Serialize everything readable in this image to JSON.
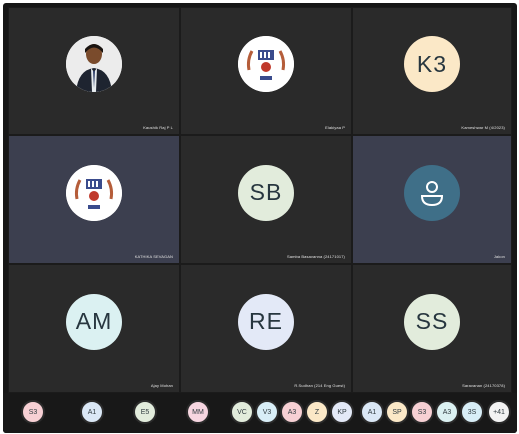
{
  "participants": [
    {
      "name": "Kaushik Raj P L",
      "avatar_type": "photo"
    },
    {
      "name": "Elakiyaa P",
      "avatar_type": "logo"
    },
    {
      "name": "Kameshwar M (4/2023)",
      "initials": "K3",
      "avatar_type": "initials",
      "color": "#fbe8c7"
    },
    {
      "name": "KATHIKA SEVAGAN",
      "avatar_type": "logo"
    },
    {
      "name": "Samba Basavanna (24171017)",
      "initials": "SB",
      "avatar_type": "initials",
      "color": "#e2ecdc"
    },
    {
      "name": "Jakon",
      "avatar_type": "icon",
      "icon": "user-silhouette-icon",
      "color": "#3f6f88"
    },
    {
      "name": "Ajay Mohan",
      "initials": "AM",
      "avatar_type": "initials",
      "color": "#dbf1f2"
    },
    {
      "name": "R.Sudhan (214 Eng Guest)",
      "initials": "RE",
      "avatar_type": "initials",
      "color": "#e3e9f7"
    },
    {
      "name": "Saravanan (24170378)",
      "initials": "SS",
      "avatar_type": "initials",
      "color": "#e2ecdc"
    }
  ],
  "participant_strip": [
    {
      "initials": "S3",
      "color": "#f7d0d4"
    },
    {
      "initials": "A1",
      "color": "#dbe8f6"
    },
    {
      "initials": "E5",
      "color": "#e2ecdc"
    },
    {
      "initials": "MM",
      "color": "#f7d6e1"
    },
    {
      "initials": "VC",
      "color": "#e2ecdc"
    },
    {
      "initials": "V3",
      "color": "#d8eef7"
    },
    {
      "initials": "A3",
      "color": "#f7d0d4"
    },
    {
      "initials": "Z",
      "color": "#fbe8c7"
    },
    {
      "initials": "KP",
      "color": "#e3e9f7"
    },
    {
      "initials": "A1",
      "color": "#dbe8f6"
    },
    {
      "initials": "SP",
      "color": "#fbe8c7"
    },
    {
      "initials": "S3",
      "color": "#f7d0d4"
    },
    {
      "initials": "A3",
      "color": "#dbf1f2"
    },
    {
      "initials": "3S",
      "color": "#d8eef7"
    },
    {
      "initials": "+41",
      "color": "#f3f3f3"
    }
  ]
}
